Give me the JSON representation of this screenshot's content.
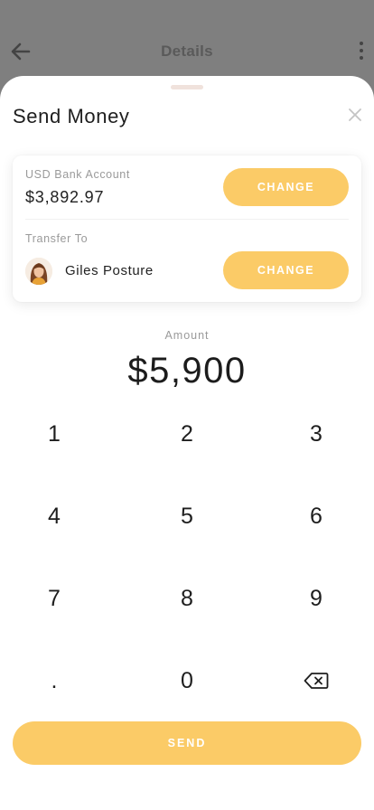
{
  "background_header": {
    "title": "Details",
    "back_icon": "arrow-left-icon",
    "more_icon": "more-vertical-icon"
  },
  "sheet": {
    "title": "Send Money",
    "close_icon": "close-icon"
  },
  "account": {
    "label": "USD Bank Account",
    "balance": "$3,892.97",
    "change_label": "CHANGE"
  },
  "transfer": {
    "label": "Transfer To",
    "recipient_name": "Giles Posture",
    "avatar_icon": "avatar-icon",
    "change_label": "CHANGE"
  },
  "amount": {
    "label": "Amount",
    "value": "$5,900"
  },
  "keypad": {
    "keys": [
      "1",
      "2",
      "3",
      "4",
      "5",
      "6",
      "7",
      "8",
      "9",
      ".",
      "0"
    ],
    "backspace_icon": "backspace-icon"
  },
  "send_label": "SEND",
  "colors": {
    "accent": "#fbcb67",
    "overlay": "#7f7f7f",
    "text": "#1e1e1e",
    "muted": "#9a9a9a"
  }
}
